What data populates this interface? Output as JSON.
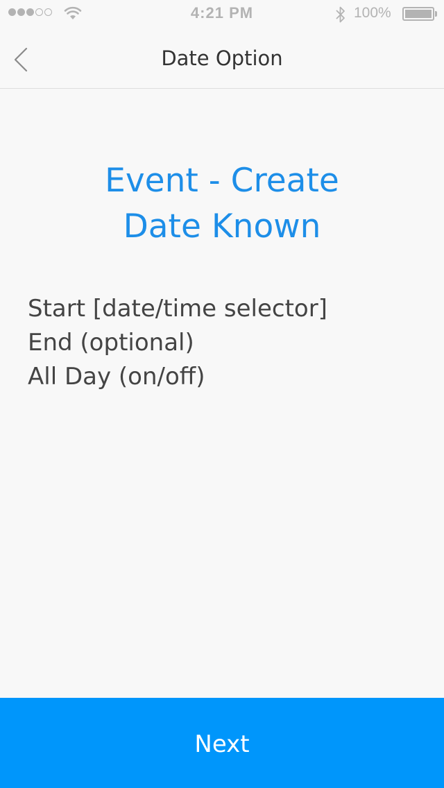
{
  "status_bar": {
    "time": "4:21 PM",
    "battery_percent": "100%",
    "signal_filled": 3,
    "signal_total": 5,
    "icons": [
      "signal-icon",
      "wifi-icon",
      "bluetooth-icon",
      "battery-icon"
    ]
  },
  "nav": {
    "title": "Date Option",
    "back_icon": "chevron-left-icon"
  },
  "content": {
    "heading_line1": "Event - Create",
    "heading_line2": "Date Known",
    "options": [
      "Start [date/time selector]",
      "End (optional)",
      "All Day (on/off)"
    ]
  },
  "footer": {
    "next_label": "Next"
  },
  "colors": {
    "accent": "#0096fb",
    "heading": "#1d8ee8",
    "background": "#f8f8f8",
    "status_gray": "#b3b3b3"
  }
}
